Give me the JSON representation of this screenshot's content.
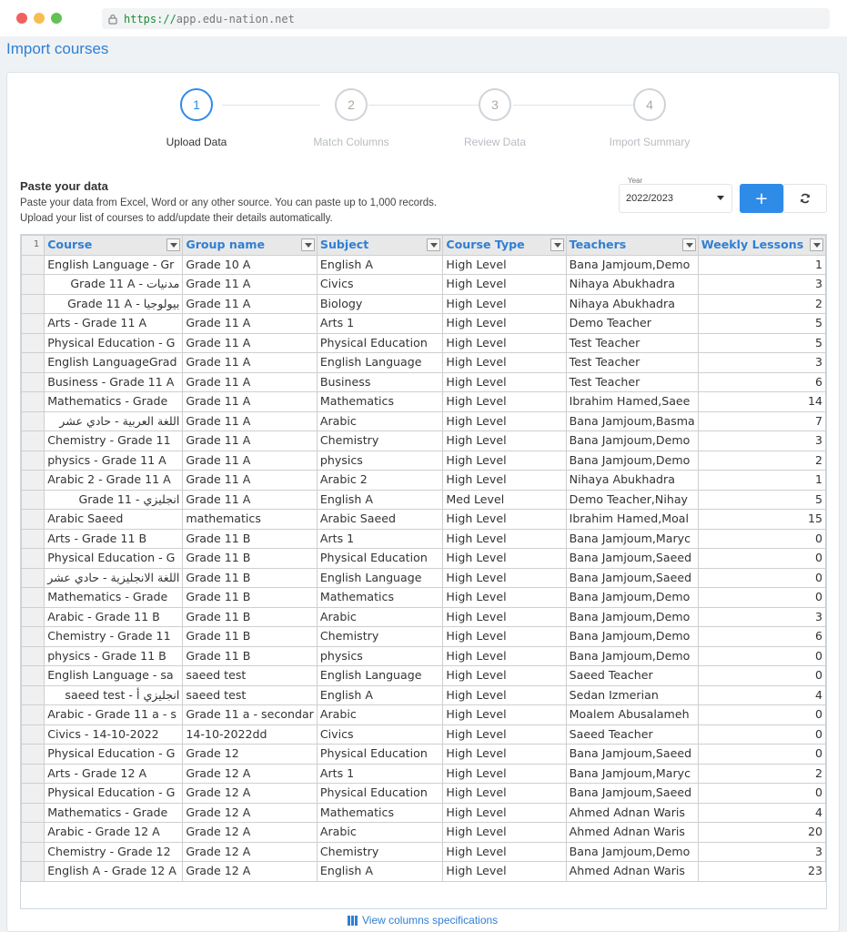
{
  "browser": {
    "url_protocol": "https://",
    "url_host": "app.edu-nation.net"
  },
  "page": {
    "title": "Import courses"
  },
  "stepper": [
    {
      "number": "1",
      "label": "Upload Data",
      "active": true
    },
    {
      "number": "2",
      "label": "Match Columns",
      "active": false
    },
    {
      "number": "3",
      "label": "Review Data",
      "active": false
    },
    {
      "number": "4",
      "label": "Import Summary",
      "active": false
    }
  ],
  "paste": {
    "title": "Paste your data",
    "line1": "Paste your data from Excel, Word or any other source. You can paste up to 1,000 records.",
    "line2": "Upload your list of courses to add/update their details automatically."
  },
  "year": {
    "label": "Year",
    "value": "2022/2023"
  },
  "buttons": {
    "add": "+",
    "refresh_icon": "refresh-icon"
  },
  "grid": {
    "first_row_number": "1",
    "columns": [
      "Course",
      "Group name",
      "Subject",
      "Course Type",
      "Teachers",
      "Weekly Lessons"
    ],
    "rows": [
      [
        "English Language - Gr",
        "Grade 10 A",
        "English A",
        "High Level",
        "Bana Jamjoum,Demo",
        "1"
      ],
      [
        "مدنيات - Grade 11 A",
        "Grade 11 A",
        "Civics",
        "High Level",
        "Nihaya Abukhadra",
        "3"
      ],
      [
        "بيولوجيا - Grade 11 A",
        "Grade 11 A",
        "Biology",
        "High Level",
        "Nihaya Abukhadra",
        "2"
      ],
      [
        "Arts - Grade 11 A",
        "Grade 11 A",
        "Arts 1",
        "High Level",
        "Demo Teacher",
        "5"
      ],
      [
        "Physical Education - G",
        "Grade 11 A",
        "Physical Education",
        "High Level",
        "Test Teacher",
        "5"
      ],
      [
        "English LanguageGrad",
        "Grade 11 A",
        "English Language",
        "High Level",
        "Test Teacher",
        "3"
      ],
      [
        "Business - Grade 11 A",
        "Grade 11 A",
        "Business",
        "High Level",
        "Test Teacher",
        "6"
      ],
      [
        "Mathematics - Grade",
        "Grade 11 A",
        "Mathematics",
        "High Level",
        "Ibrahim Hamed,Saee",
        "14"
      ],
      [
        "اللغة العربية - حادي عشر",
        "Grade 11 A",
        "Arabic",
        "High Level",
        "Bana Jamjoum,Basma",
        "7"
      ],
      [
        "Chemistry - Grade 11",
        "Grade 11 A",
        "Chemistry",
        "High Level",
        "Bana Jamjoum,Demo",
        "3"
      ],
      [
        "physics - Grade 11 A",
        "Grade 11 A",
        "physics",
        "High Level",
        "Bana Jamjoum,Demo",
        "2"
      ],
      [
        "Arabic 2 - Grade 11 A",
        "Grade 11 A",
        "Arabic 2",
        "High Level",
        "Nihaya Abukhadra",
        "1"
      ],
      [
        "انجليزي - Grade 11",
        "Grade 11 A",
        "English A",
        "Med Level",
        "Demo Teacher,Nihay",
        "5"
      ],
      [
        "Arabic Saeed",
        "mathematics",
        "Arabic Saeed",
        "High Level",
        "Ibrahim Hamed,Moal",
        "15"
      ],
      [
        "Arts - Grade 11 B",
        "Grade 11 B",
        "Arts 1",
        "High Level",
        "Bana Jamjoum,Maryc",
        "0"
      ],
      [
        "Physical Education - G",
        "Grade 11 B",
        "Physical Education",
        "High Level",
        "Bana Jamjoum,Saeed",
        "0"
      ],
      [
        "اللغة الانجليزية - حادي عشر",
        "Grade 11 B",
        "English Language",
        "High Level",
        "Bana Jamjoum,Saeed",
        "0"
      ],
      [
        "Mathematics - Grade",
        "Grade 11 B",
        "Mathematics",
        "High Level",
        "Bana Jamjoum,Demo",
        "0"
      ],
      [
        "Arabic - Grade 11 B",
        "Grade 11 B",
        "Arabic",
        "High Level",
        "Bana Jamjoum,Demo",
        "3"
      ],
      [
        "Chemistry - Grade 11",
        "Grade 11 B",
        "Chemistry",
        "High Level",
        "Bana Jamjoum,Demo",
        "6"
      ],
      [
        "physics - Grade 11 B",
        "Grade 11 B",
        "physics",
        "High Level",
        "Bana Jamjoum,Demo",
        "0"
      ],
      [
        "English Language - sa",
        "saeed test",
        "English Language",
        "High Level",
        "Saeed Teacher",
        "0"
      ],
      [
        "انجليزي أ - saeed test",
        "saeed test",
        "English A",
        "High Level",
        "Sedan Izmerian",
        "4"
      ],
      [
        "Arabic - Grade 11 a - s",
        "Grade 11 a - secondar",
        "Arabic",
        "High Level",
        "Moalem Abusalameh",
        "0"
      ],
      [
        "Civics - 14-10-2022",
        "14-10-2022dd",
        "Civics",
        "High Level",
        "Saeed Teacher",
        "0"
      ],
      [
        "Physical Education - G",
        "Grade 12",
        "Physical Education",
        "High Level",
        "Bana Jamjoum,Saeed",
        "0"
      ],
      [
        "Arts - Grade 12 A",
        "Grade 12 A",
        "Arts 1",
        "High Level",
        "Bana Jamjoum,Maryc",
        "2"
      ],
      [
        "Physical Education - G",
        "Grade 12 A",
        "Physical Education",
        "High Level",
        "Bana Jamjoum,Saeed",
        "0"
      ],
      [
        "Mathematics - Grade",
        "Grade 12 A",
        "Mathematics",
        "High Level",
        "Ahmed Adnan Waris",
        "4"
      ],
      [
        "Arabic - Grade 12 A",
        "Grade 12 A",
        "Arabic",
        "High Level",
        "Ahmed Adnan Waris",
        "20"
      ],
      [
        "Chemistry - Grade 12",
        "Grade 12 A",
        "Chemistry",
        "High Level",
        "Bana Jamjoum,Demo",
        "3"
      ],
      [
        "English A - Grade 12 A",
        "Grade 12 A",
        "English A",
        "High Level",
        "Ahmed Adnan Waris",
        "23"
      ]
    ],
    "rtl_first_cell_rows": [
      1,
      2,
      8,
      12,
      16,
      22
    ]
  },
  "footer": {
    "view_specs": "View columns specifications"
  }
}
